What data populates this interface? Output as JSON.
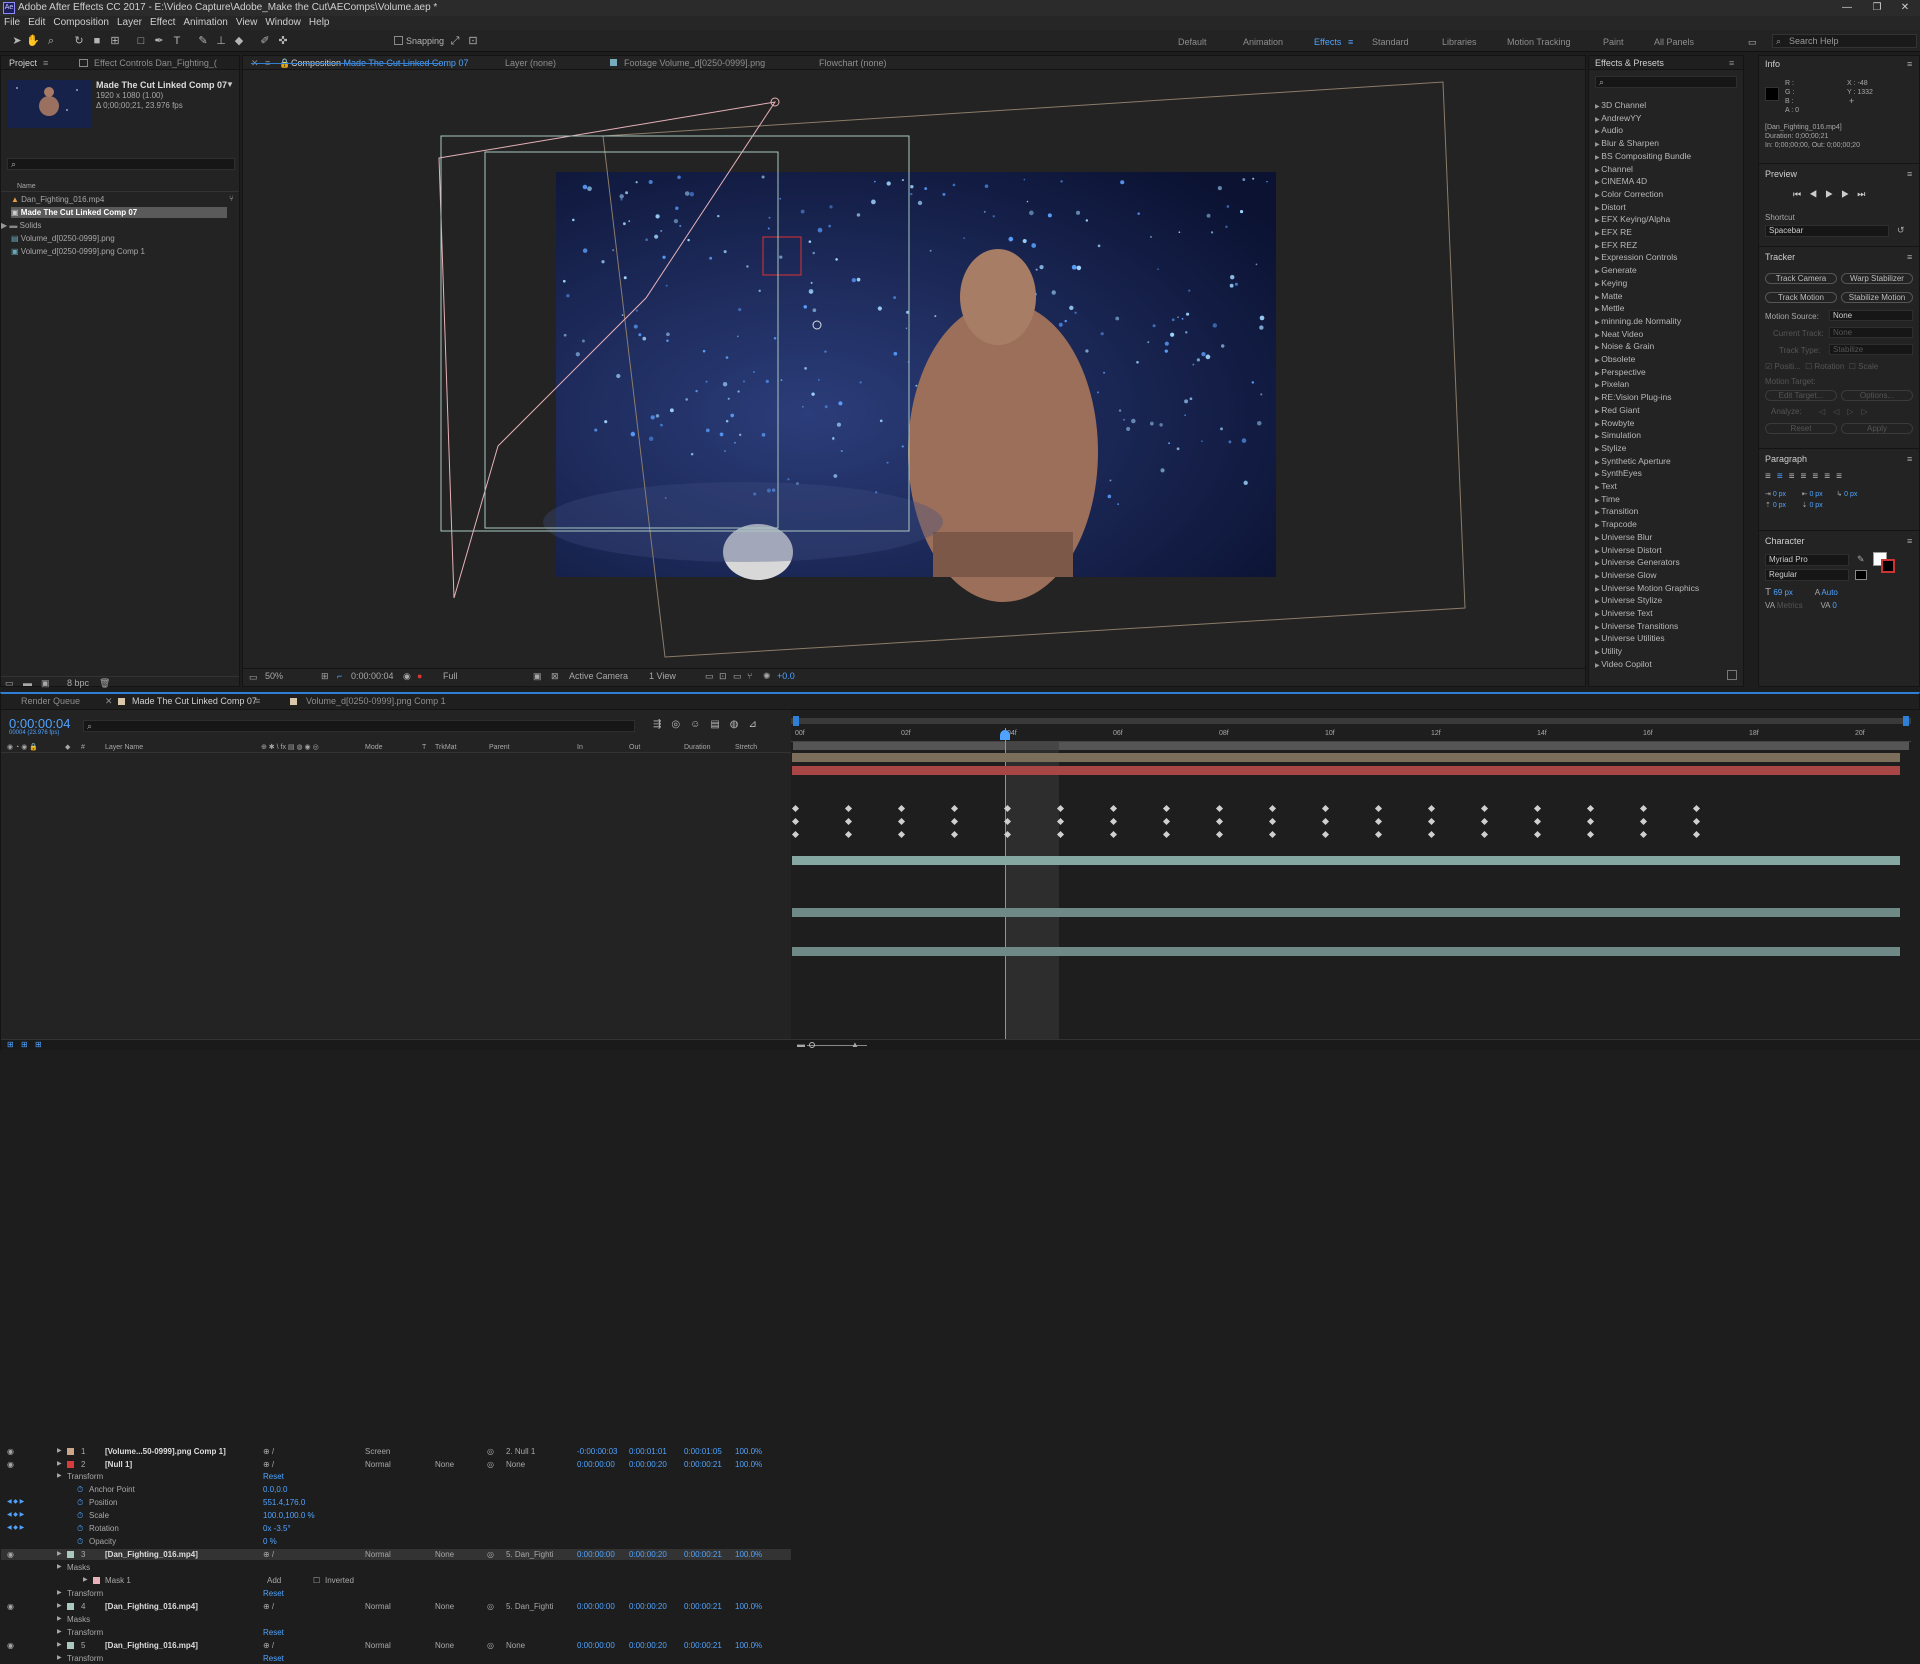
{
  "window": {
    "title": "Adobe After Effects CC 2017 - E:\\Video Capture\\Adobe_Make the Cut\\AEComps\\Volume.aep *",
    "logo": "Ae",
    "min": "—",
    "max": "❐",
    "close": "✕"
  },
  "menu": [
    "File",
    "Edit",
    "Composition",
    "Layer",
    "Effect",
    "Animation",
    "View",
    "Window",
    "Help"
  ],
  "toolbar": {
    "snapping": "Snapping"
  },
  "workspaces": [
    "Default",
    "Animation",
    "Effects",
    "Standard",
    "Libraries",
    "Motion Tracking",
    "Paint",
    "All Panels"
  ],
  "search_help": "Search Help",
  "project": {
    "tab": "Project",
    "tab2": "Effect Controls Dan_Fighting_(",
    "comp_name": "Made The Cut Linked Comp 07",
    "comp_res": "1920 x 1080 (1.00)",
    "comp_dur": "Δ 0;00;00;21, 23.976 fps",
    "col_name": "Name",
    "items": [
      "Dan_Fighting_016.mp4",
      "Made The Cut Linked Comp 07",
      "Solids",
      "Volume_d[0250-0999].png",
      "Volume_d[0250-0999].png Comp 1"
    ],
    "bpc": "8 bpc"
  },
  "viewer": {
    "tab_comp_prefix": "Composition",
    "tab_comp": "Made The Cut Linked Comp 07",
    "tab_layer": "Layer (none)",
    "tab_footage": "Footage Volume_d[0250-0999].png",
    "tab_flow": "Flowchart (none)",
    "zoom": "50%",
    "time": "0:00:00:04",
    "res": "Full",
    "camera": "Active Camera",
    "views": "1 View",
    "exposure": "+0.0"
  },
  "effects": {
    "title": "Effects & Presets",
    "items": [
      "3D Channel",
      "AndrewYY",
      "Audio",
      "Blur & Sharpen",
      "BS Compositing Bundle",
      "Channel",
      "CINEMA 4D",
      "Color Correction",
      "Distort",
      "EFX Keying/Alpha",
      "EFX RE",
      "EFX REZ",
      "Expression Controls",
      "Generate",
      "Keying",
      "Matte",
      "Mettle",
      "minning.de Normality",
      "Neat Video",
      "Noise & Grain",
      "Obsolete",
      "Perspective",
      "Pixelan",
      "RE:Vision Plug-ins",
      "Red Giant",
      "Rowbyte",
      "Simulation",
      "Stylize",
      "Synthetic Aperture",
      "SynthEyes",
      "Text",
      "Time",
      "Transition",
      "Trapcode",
      "Universe Blur",
      "Universe Distort",
      "Universe Generators",
      "Universe Glow",
      "Universe Motion Graphics",
      "Universe Stylize",
      "Universe Text",
      "Universe Transitions",
      "Universe Utilities",
      "Utility",
      "Video Copilot"
    ]
  },
  "info": {
    "title": "Info",
    "r": "R :",
    "g": "G :",
    "b": "B :",
    "a": "A : 0",
    "x": "X : -48",
    "y": "Y : 1332",
    "file": "[Dan_Fighting_016.mp4]",
    "duration": "Duration: 0;00;00;21",
    "inout": "In: 0;00;00;00, Out: 0;00;00;20"
  },
  "preview": {
    "title": "Preview",
    "shortcut_label": "Shortcut",
    "shortcut": "Spacebar"
  },
  "tracker": {
    "title": "Tracker",
    "track_camera": "Track Camera",
    "warp_stabilizer": "Warp Stabilizer",
    "track_motion": "Track Motion",
    "stabilize_motion": "Stabilize Motion",
    "motion_source_label": "Motion Source:",
    "motion_source": "None",
    "current_track_label": "Current Track:",
    "current_track": "None",
    "track_type_label": "Track Type:",
    "track_type": "Stabilize",
    "position": "Positi...",
    "rotation": "Rotation",
    "scale": "Scale",
    "motion_target": "Motion Target:",
    "edit_target": "Edit Target...",
    "options": "Options...",
    "analyze": "Analyze:",
    "reset": "Reset",
    "apply": "Apply"
  },
  "paragraph": {
    "title": "Paragraph",
    "v1": "0 px",
    "v2": "0 px",
    "v3": "0 px",
    "v4": "0 px",
    "v5": "0 px"
  },
  "character": {
    "title": "Character",
    "font": "Myriad Pro",
    "style": "Regular",
    "size": "69 px",
    "leading": "Auto",
    "tracking": "0",
    "kerning": "Metrics"
  },
  "timeline": {
    "tab_render": "Render Queue",
    "tab_comp": "Made The Cut Linked Comp 07",
    "tab_comp2": "Volume_d[0250-0999].png Comp 1",
    "time": "0:00:00:04",
    "fps": "00004 (23.976 fps)",
    "headers": {
      "layer": "Layer Name",
      "mode": "Mode",
      "t": "T",
      "trkmat": "TrkMat",
      "parent": "Parent",
      "in": "In",
      "out": "Out",
      "dur": "Duration",
      "stretch": "Stretch"
    },
    "ruler": [
      "00f",
      "02f",
      "04f",
      "06f",
      "08f",
      "10f",
      "12f",
      "14f",
      "16f",
      "18f",
      "20f"
    ],
    "layers": [
      {
        "num": "1",
        "name": "[Volume...50-0999].png Comp 1]",
        "mode": "Screen",
        "trkmat": "",
        "parent": "2. Null 1",
        "in": "-0:00:00:03",
        "out": "0:00:01:01",
        "dur": "0:00:01:05",
        "stretch": "100.0%"
      },
      {
        "num": "2",
        "name": "[Null 1]",
        "mode": "Normal",
        "trkmat": "None",
        "parent": "None",
        "in": "0:00:00:00",
        "out": "0:00:00:20",
        "dur": "0:00:00:21",
        "stretch": "100.0%"
      },
      {
        "num": "3",
        "name": "[Dan_Fighting_016.mp4]",
        "mode": "Normal",
        "trkmat": "None",
        "parent": "5. Dan_Fighti",
        "in": "0:00:00:00",
        "out": "0:00:00:20",
        "dur": "0:00:00:21",
        "stretch": "100.0%"
      },
      {
        "num": "4",
        "name": "[Dan_Fighting_016.mp4]",
        "mode": "Normal",
        "trkmat": "None",
        "parent": "5. Dan_Fighti",
        "in": "0:00:00:00",
        "out": "0:00:00:20",
        "dur": "0:00:00:21",
        "stretch": "100.0%"
      },
      {
        "num": "5",
        "name": "[Dan_Fighting_016.mp4]",
        "mode": "Normal",
        "trkmat": "None",
        "parent": "None",
        "in": "0:00:00:00",
        "out": "0:00:00:20",
        "dur": "0:00:00:21",
        "stretch": "100.0%"
      }
    ],
    "props": {
      "transform": "Transform",
      "reset": "Reset",
      "anchor": "Anchor Point",
      "anchor_v": "0.0,0.0",
      "position": "Position",
      "position_v": "551.4,176.0",
      "scale": "Scale",
      "scale_v": "100.0,100.0 %",
      "rotation": "Rotation",
      "rotation_v": "0x -3.5°",
      "opacity": "Opacity",
      "opacity_v": "0 %",
      "masks": "Masks",
      "mask1": "Mask 1",
      "add": "Add",
      "inverted": "Inverted"
    }
  }
}
